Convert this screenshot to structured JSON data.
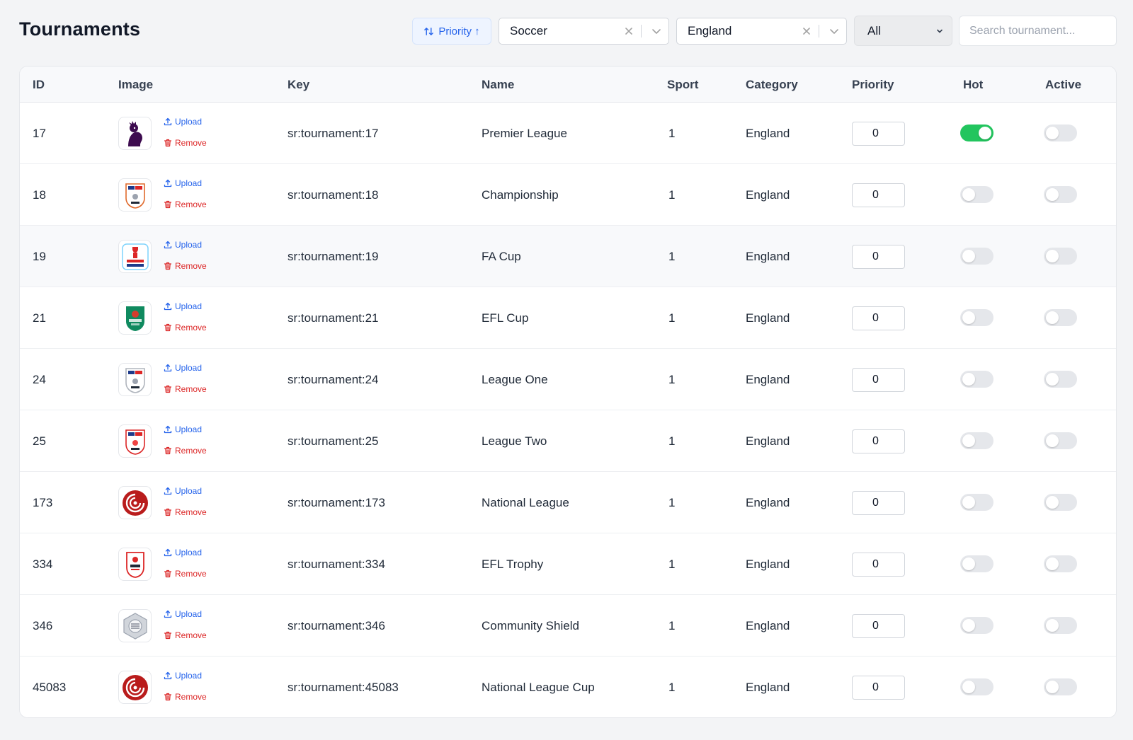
{
  "header": {
    "title": "Tournaments",
    "sort_button": "Priority ↑",
    "sport_filter": "Soccer",
    "category_filter": "England",
    "status_filter": "All",
    "search_placeholder": "Search tournament..."
  },
  "table": {
    "columns": [
      "ID",
      "Image",
      "Key",
      "Name",
      "Sport",
      "Category",
      "Priority",
      "Hot",
      "Active"
    ],
    "upload_label": "Upload",
    "remove_label": "Remove",
    "rows": [
      {
        "id": "17",
        "key": "sr:tournament:17",
        "name": "Premier League",
        "sport": "1",
        "category": "England",
        "priority": "0",
        "hot": true,
        "active": false,
        "logo": "premier-league-logo"
      },
      {
        "id": "18",
        "key": "sr:tournament:18",
        "name": "Championship",
        "sport": "1",
        "category": "England",
        "priority": "0",
        "hot": false,
        "active": false,
        "logo": "championship-logo"
      },
      {
        "id": "19",
        "key": "sr:tournament:19",
        "name": "FA Cup",
        "sport": "1",
        "category": "England",
        "priority": "0",
        "hot": false,
        "active": false,
        "logo": "fa-cup-logo"
      },
      {
        "id": "21",
        "key": "sr:tournament:21",
        "name": "EFL Cup",
        "sport": "1",
        "category": "England",
        "priority": "0",
        "hot": false,
        "active": false,
        "logo": "efl-cup-logo"
      },
      {
        "id": "24",
        "key": "sr:tournament:24",
        "name": "League One",
        "sport": "1",
        "category": "England",
        "priority": "0",
        "hot": false,
        "active": false,
        "logo": "league-one-logo"
      },
      {
        "id": "25",
        "key": "sr:tournament:25",
        "name": "League Two",
        "sport": "1",
        "category": "England",
        "priority": "0",
        "hot": false,
        "active": false,
        "logo": "league-two-logo"
      },
      {
        "id": "173",
        "key": "sr:tournament:173",
        "name": "National League",
        "sport": "1",
        "category": "England",
        "priority": "0",
        "hot": false,
        "active": false,
        "logo": "national-league-logo"
      },
      {
        "id": "334",
        "key": "sr:tournament:334",
        "name": "EFL Trophy",
        "sport": "1",
        "category": "England",
        "priority": "0",
        "hot": false,
        "active": false,
        "logo": "efl-trophy-logo"
      },
      {
        "id": "346",
        "key": "sr:tournament:346",
        "name": "Community Shield",
        "sport": "1",
        "category": "England",
        "priority": "0",
        "hot": false,
        "active": false,
        "logo": "community-shield-logo"
      },
      {
        "id": "45083",
        "key": "sr:tournament:45083",
        "name": "National League Cup",
        "sport": "1",
        "category": "England",
        "priority": "0",
        "hot": false,
        "active": false,
        "logo": "national-league-logo"
      }
    ]
  },
  "colors": {
    "accent": "#2563eb",
    "danger": "#dc2626",
    "toggle_on": "#22c55e",
    "toggle_off": "#e5e7eb"
  }
}
